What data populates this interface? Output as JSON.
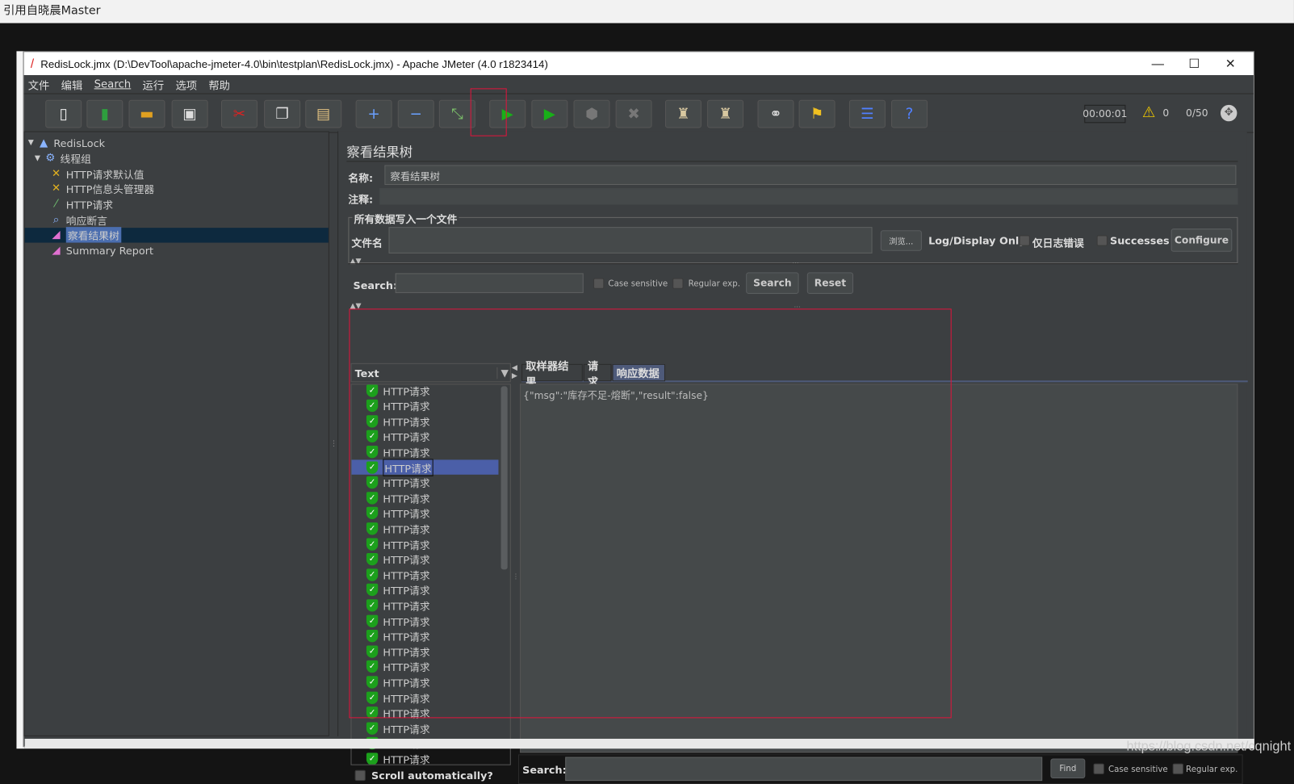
{
  "background_page": {
    "header_text": "引用自晓晨Master",
    "watermark": "https://blog.csdn.net/cqnight"
  },
  "window": {
    "title": "RedisLock.jmx (D:\\DevTool\\apache-jmeter-4.0\\bin\\testplan\\RedisLock.jmx) - Apache JMeter (4.0 r1823414)"
  },
  "menu": [
    "文件",
    "编辑",
    "Search",
    "运行",
    "选项",
    "帮助"
  ],
  "toolbar": {
    "buttons": [
      {
        "name": "new",
        "icon": "new-file-icon",
        "glyph": "▯",
        "color": "#eeeeee"
      },
      {
        "name": "templates",
        "icon": "templates-icon",
        "glyph": "▮",
        "color": "#2e9e3e"
      },
      {
        "name": "open",
        "icon": "folder-open-icon",
        "glyph": "▬",
        "color": "#e0a020"
      },
      {
        "name": "save",
        "icon": "save-icon",
        "glyph": "▣",
        "color": "#dddddd"
      },
      {
        "name": "cut",
        "icon": "scissors-icon",
        "glyph": "✂",
        "color": "#e02020"
      },
      {
        "name": "copy",
        "icon": "copy-icon",
        "glyph": "❐",
        "color": "#dddddd"
      },
      {
        "name": "paste",
        "icon": "clipboard-icon",
        "glyph": "▤",
        "color": "#e0c080"
      },
      {
        "name": "expand",
        "icon": "plus-icon",
        "glyph": "+",
        "color": "#6aa0ff"
      },
      {
        "name": "collapse",
        "icon": "minus-icon",
        "glyph": "−",
        "color": "#6aa0ff"
      },
      {
        "name": "toggle",
        "icon": "toggle-icon",
        "glyph": "⤡",
        "color": "#7cc06a"
      },
      {
        "name": "start",
        "icon": "play-icon",
        "glyph": "▶",
        "color": "#18b018"
      },
      {
        "name": "start-no-pause",
        "icon": "play-no-timers-icon",
        "glyph": "▶",
        "color": "#18b018"
      },
      {
        "name": "stop",
        "icon": "stop-icon",
        "glyph": "⬢",
        "color": "#777777"
      },
      {
        "name": "shutdown",
        "icon": "shutdown-icon",
        "glyph": "✖",
        "color": "#777777"
      },
      {
        "name": "clear",
        "icon": "clear-icon",
        "glyph": "♜",
        "color": "#d8c8a0"
      },
      {
        "name": "clear-all",
        "icon": "clear-all-icon",
        "glyph": "♜",
        "color": "#d8c8a0"
      },
      {
        "name": "search",
        "icon": "binoculars-icon",
        "glyph": "⚭",
        "color": "#dddddd"
      },
      {
        "name": "reset-search",
        "icon": "broom-icon",
        "glyph": "⚑",
        "color": "#f0c020"
      },
      {
        "name": "function-helper",
        "icon": "list-icon",
        "glyph": "☰",
        "color": "#5080ff"
      },
      {
        "name": "help",
        "icon": "help-icon",
        "glyph": "?",
        "color": "#5080ff"
      }
    ],
    "elapsed": "00:00:01",
    "warnings": "0",
    "threads": "0/50"
  },
  "tree": [
    {
      "label": "RedisLock",
      "icon": "flask-icon",
      "glyph": "▲",
      "level": 0,
      "expanded": true
    },
    {
      "label": "线程组",
      "icon": "gear-icon",
      "glyph": "⚙",
      "level": 1,
      "expanded": true
    },
    {
      "label": "HTTP请求默认值",
      "icon": "wrench-icon",
      "glyph": "✕",
      "level": 2
    },
    {
      "label": "HTTP信息头管理器",
      "icon": "wrench-icon",
      "glyph": "✕",
      "level": 2
    },
    {
      "label": "HTTP请求",
      "icon": "pipette-icon",
      "glyph": "⁄",
      "level": 2
    },
    {
      "label": "响应断言",
      "icon": "magnifier-icon",
      "glyph": "⌕",
      "level": 2
    },
    {
      "label": "察看结果树",
      "icon": "chart-icon",
      "glyph": "◢",
      "level": 2,
      "selected": true
    },
    {
      "label": "Summary Report",
      "icon": "chart-icon",
      "glyph": "◢",
      "level": 2
    }
  ],
  "panel": {
    "title": "察看结果树",
    "name_label": "名称:",
    "name_value": "察看结果树",
    "comment_label": "注释:",
    "fieldset_legend": "所有数据写入一个文件",
    "filename_label": "文件名",
    "browse_label": "浏览...",
    "log_display_label": "Log/Display Only:",
    "errors_label": "仅日志错误",
    "successes_label": "Successes",
    "configure_label": "Configure",
    "search_label": "Search:",
    "case_sensitive_label": "Case sensitive",
    "regex_label": "Regular exp.",
    "search_button": "Search",
    "reset_button": "Reset",
    "renderer": "Text",
    "results": [
      "HTTP请求",
      "HTTP请求",
      "HTTP请求",
      "HTTP请求",
      "HTTP请求",
      "HTTP请求",
      "HTTP请求",
      "HTTP请求",
      "HTTP请求",
      "HTTP请求",
      "HTTP请求",
      "HTTP请求",
      "HTTP请求",
      "HTTP请求",
      "HTTP请求",
      "HTTP请求",
      "HTTP请求",
      "HTTP请求",
      "HTTP请求",
      "HTTP请求",
      "HTTP请求",
      "HTTP请求",
      "HTTP请求",
      "HTTP请求",
      "HTTP请求"
    ],
    "selected_result": 5,
    "tabs": [
      "取样器结果",
      "请求",
      "响应数据"
    ],
    "active_tab": 2,
    "response_text": "{\"msg\":\"库存不足-熔断\",\"result\":false}",
    "find_search_label": "Search:",
    "find_button": "Find",
    "find_case_label": "Case sensitive",
    "find_regex_label": "Regular exp.",
    "scroll_auto_label": "Scroll automatically?"
  },
  "annotation_color": "#e0143c"
}
